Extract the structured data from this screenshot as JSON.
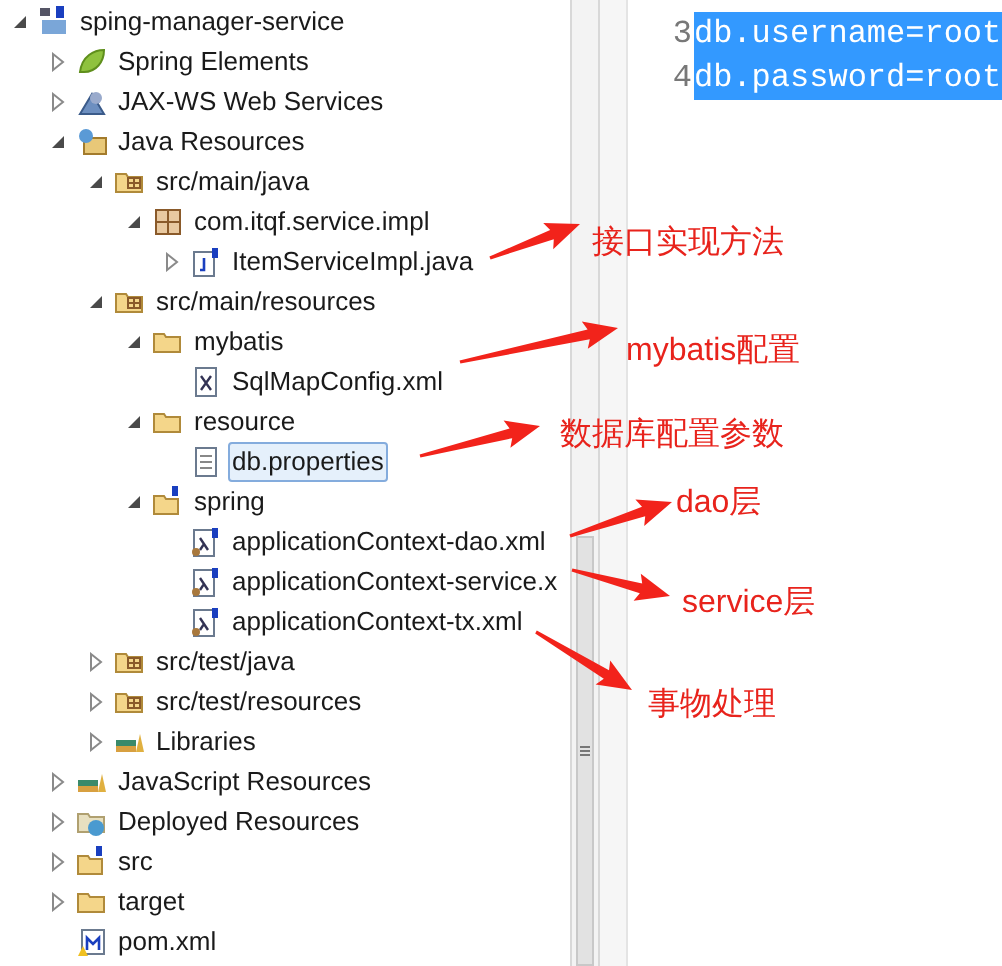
{
  "project_tree": [
    {
      "label": "sping-manager-service",
      "kind": "maven-project",
      "expanded": true,
      "selected": false,
      "children": [
        {
          "label": "Spring Elements",
          "kind": "spring",
          "expanded": false,
          "selected": false
        },
        {
          "label": "JAX-WS Web Services",
          "kind": "webservice",
          "expanded": false,
          "selected": false
        },
        {
          "label": "Java Resources",
          "kind": "java-resources",
          "expanded": true,
          "selected": false,
          "children": [
            {
              "label": "src/main/java",
              "kind": "source-folder",
              "expanded": true,
              "selected": false,
              "children": [
                {
                  "label": "com.itqf.service.impl",
                  "kind": "package",
                  "expanded": true,
                  "selected": false,
                  "children": [
                    {
                      "label": "ItemServiceImpl.java",
                      "kind": "java-file",
                      "expanded": false,
                      "selected": false
                    }
                  ]
                }
              ]
            },
            {
              "label": "src/main/resources",
              "kind": "source-folder",
              "expanded": true,
              "selected": false,
              "children": [
                {
                  "label": "mybatis",
                  "kind": "folder",
                  "expanded": true,
                  "selected": false,
                  "children": [
                    {
                      "label": "SqlMapConfig.xml",
                      "kind": "xml-file",
                      "selected": false
                    }
                  ]
                },
                {
                  "label": "resource",
                  "kind": "folder",
                  "expanded": true,
                  "selected": false,
                  "children": [
                    {
                      "label": "db.properties",
                      "kind": "properties-file",
                      "selected": true
                    }
                  ]
                },
                {
                  "label": "spring",
                  "kind": "spring-folder",
                  "expanded": true,
                  "selected": false,
                  "children": [
                    {
                      "label": "applicationContext-dao.xml",
                      "kind": "spring-xml",
                      "selected": false
                    },
                    {
                      "label": "applicationContext-service.x",
                      "kind": "spring-xml",
                      "selected": false
                    },
                    {
                      "label": "applicationContext-tx.xml",
                      "kind": "spring-xml",
                      "selected": false
                    }
                  ]
                }
              ]
            },
            {
              "label": "src/test/java",
              "kind": "source-folder",
              "expanded": false,
              "selected": false
            },
            {
              "label": "src/test/resources",
              "kind": "source-folder",
              "expanded": false,
              "selected": false
            },
            {
              "label": "Libraries",
              "kind": "libraries",
              "expanded": false,
              "selected": false
            }
          ]
        },
        {
          "label": "JavaScript Resources",
          "kind": "libraries",
          "expanded": false,
          "selected": false
        },
        {
          "label": "Deployed Resources",
          "kind": "deployed",
          "expanded": false,
          "selected": false
        },
        {
          "label": "src",
          "kind": "spring-folder",
          "expanded": false,
          "selected": false
        },
        {
          "label": "target",
          "kind": "folder",
          "expanded": false,
          "selected": false
        },
        {
          "label": "pom.xml",
          "kind": "maven-file",
          "selected": false
        }
      ]
    }
  ],
  "editor": {
    "lines": [
      {
        "number": "3",
        "text": "db.username=root",
        "selected": true
      },
      {
        "number": "4",
        "text": "db.password=root",
        "selected": true
      }
    ]
  },
  "annotations": [
    {
      "text": "接口实现方法"
    },
    {
      "text": "mybatis配置"
    },
    {
      "text": "数据库配置参数"
    },
    {
      "text": "dao层"
    },
    {
      "text": "service层"
    },
    {
      "text": "事物处理"
    }
  ]
}
